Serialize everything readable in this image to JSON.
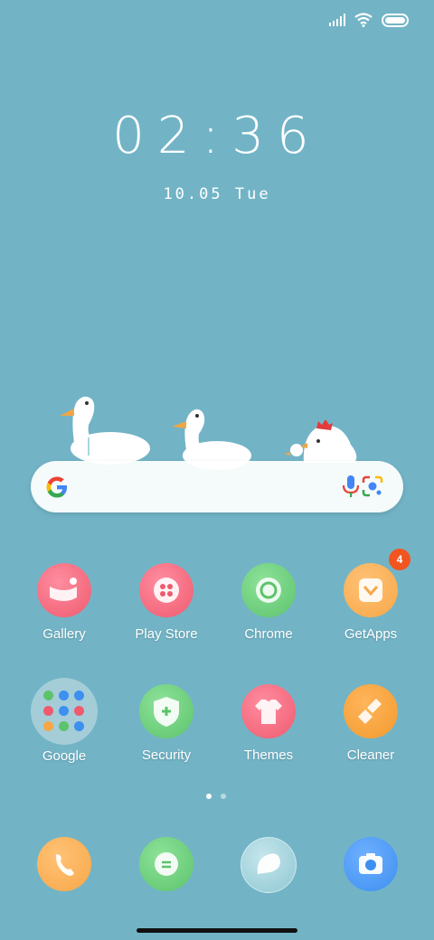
{
  "status": {
    "signal": "signal-icon",
    "wifi": "wifi-icon",
    "battery": "battery-icon"
  },
  "clock": {
    "time": "02:36",
    "date": "10.05 Tue"
  },
  "search": {
    "logo": "google-g-icon",
    "voice": "mic-icon",
    "lens": "lens-icon"
  },
  "apps": [
    {
      "label": "Gallery",
      "icon": "gallery-icon",
      "color": "#ef5a6e"
    },
    {
      "label": "Play Store",
      "icon": "play-store-icon",
      "color": "#ef5a6e"
    },
    {
      "label": "Chrome",
      "icon": "chrome-icon",
      "color": "#5cc36b"
    },
    {
      "label": "GetApps",
      "icon": "getapps-icon",
      "color": "#f7a746",
      "badge": "4"
    },
    {
      "label": "Google",
      "icon": "folder-icon",
      "color": "#cde1e8"
    },
    {
      "label": "Security",
      "icon": "security-icon",
      "color": "#5cc36b"
    },
    {
      "label": "Themes",
      "icon": "themes-icon",
      "color": "#ef5a6e"
    },
    {
      "label": "Cleaner",
      "icon": "cleaner-icon",
      "color": "#f39a2f"
    }
  ],
  "dock": [
    {
      "icon": "phone-icon",
      "color": "#f7a746"
    },
    {
      "icon": "messages-icon",
      "color": "#5cc36b"
    },
    {
      "icon": "browser-icon",
      "color": "#a7d3dc"
    },
    {
      "icon": "camera-icon",
      "color": "#3d8ff0"
    }
  ],
  "pages": {
    "count": 2,
    "current": 1
  }
}
